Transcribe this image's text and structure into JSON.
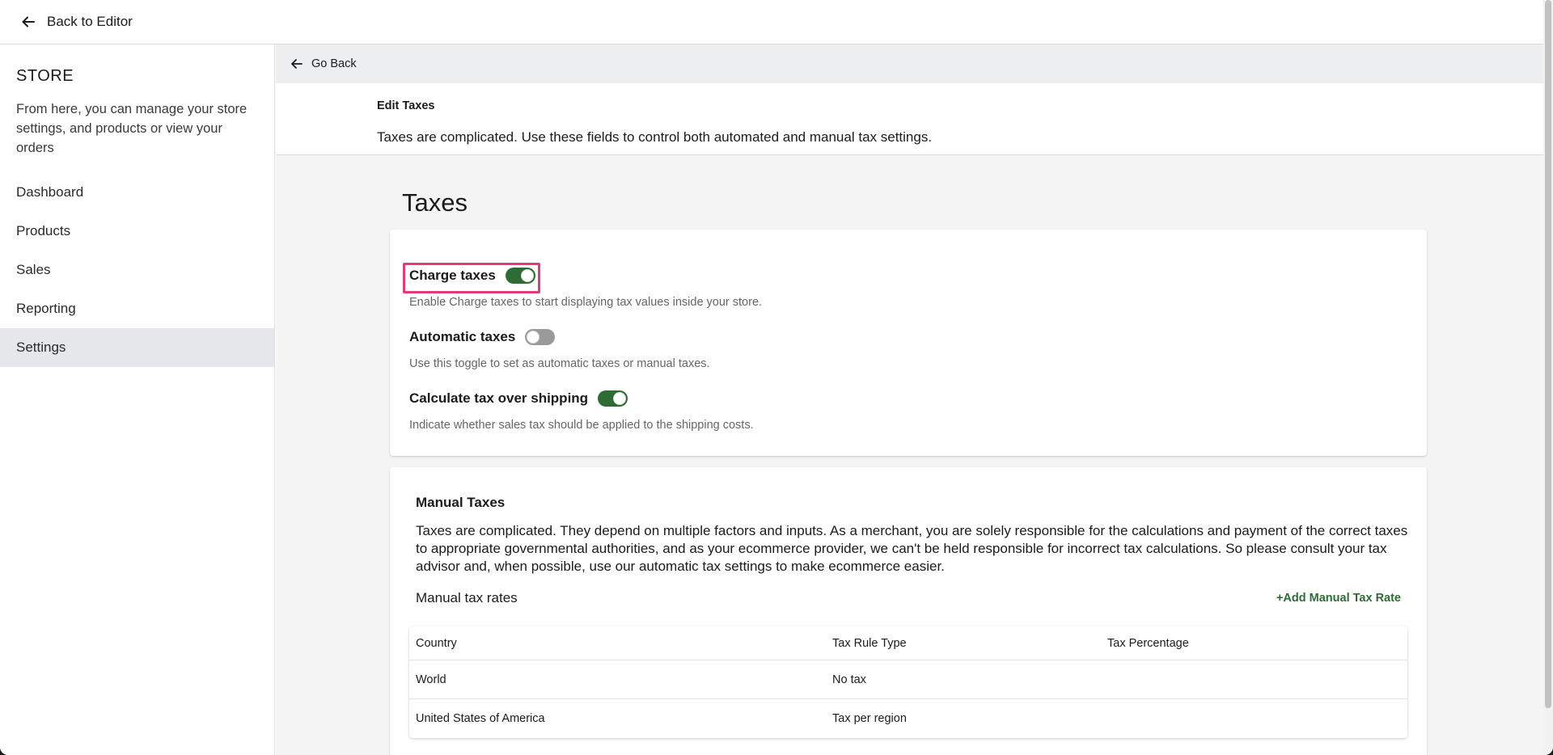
{
  "topbar": {
    "back_label": "Back to Editor"
  },
  "sidebar": {
    "title": "STORE",
    "description": "From here, you can manage your store settings, and products or view your orders",
    "items": [
      {
        "label": "Dashboard"
      },
      {
        "label": "Products"
      },
      {
        "label": "Sales"
      },
      {
        "label": "Reporting"
      },
      {
        "label": "Settings",
        "active": true
      }
    ]
  },
  "main": {
    "go_back_label": "Go Back",
    "edit_title": "Edit Taxes",
    "edit_description": "Taxes are complicated. Use these fields to control both automated and manual tax settings.",
    "heading": "Taxes"
  },
  "tax_settings": {
    "charge_taxes": {
      "label": "Charge taxes",
      "hint": "Enable Charge taxes to start displaying tax values inside your store.",
      "enabled": true
    },
    "automatic_taxes": {
      "label": "Automatic taxes",
      "hint": "Use this toggle to set as automatic taxes or manual taxes.",
      "enabled": false
    },
    "tax_over_shipping": {
      "label": "Calculate tax over shipping",
      "hint": "Indicate whether sales tax should be applied to the shipping costs.",
      "enabled": true
    }
  },
  "manual_taxes": {
    "title": "Manual Taxes",
    "description": "Taxes are complicated. They depend on multiple factors and inputs. As a merchant, you are solely responsible for the calculations and payment of the correct taxes to appropriate governmental authorities, and as your ecommerce provider, we can't be held responsible for incorrect tax calculations. So please consult your tax advisor and, when possible, use our automatic tax settings to make ecommerce easier.",
    "rates_label": "Manual tax rates",
    "add_label": "+Add Manual Tax Rate",
    "table": {
      "headers": [
        "Country",
        "Tax Rule Type",
        "Tax Percentage"
      ],
      "rows": [
        [
          "World",
          "No tax",
          ""
        ],
        [
          "United States of America",
          "Tax per region",
          ""
        ]
      ]
    }
  },
  "colors": {
    "accent_green": "#2e6b35",
    "highlight_pink": "#e4387a",
    "sidebar_active": "#e6e7ea"
  }
}
